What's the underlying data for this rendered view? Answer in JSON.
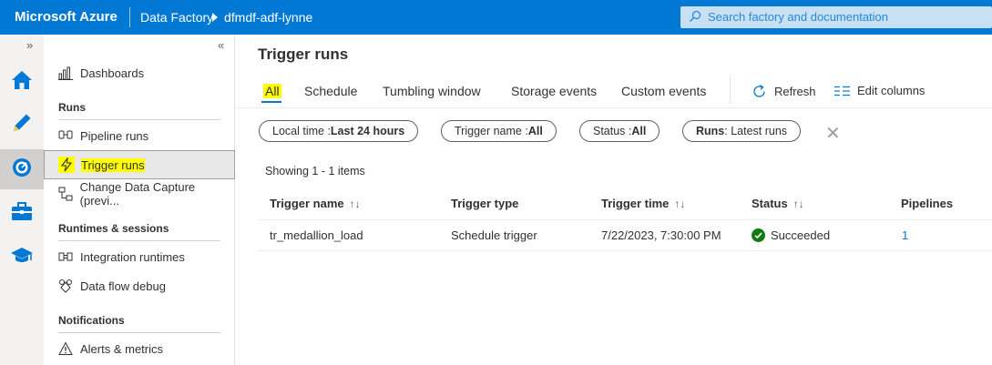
{
  "topbar": {
    "brand": "Microsoft Azure",
    "crumb_service": "Data Factory",
    "crumb_factory": "dfmdf-adf-lynne",
    "search_placeholder": "Search factory and documentation"
  },
  "rail": {
    "collapse": "»",
    "items": [
      {
        "icon": "home-icon"
      },
      {
        "icon": "pencil-icon"
      },
      {
        "icon": "monitor-icon",
        "active": true
      },
      {
        "icon": "toolbox-icon"
      },
      {
        "icon": "graduation-cap-icon"
      }
    ]
  },
  "sidenav": {
    "collapse": "«",
    "dashboards": "Dashboards",
    "runs_header": "Runs",
    "pipeline_runs": "Pipeline runs",
    "trigger_runs": "Trigger runs",
    "change_data_capture": "Change Data Capture (previ...",
    "runtimes_header": "Runtimes & sessions",
    "integration_runtimes": "Integration runtimes",
    "data_flow_debug": "Data flow debug",
    "notifications_header": "Notifications",
    "alerts_metrics": "Alerts & metrics"
  },
  "main": {
    "title": "Trigger runs",
    "tabs": [
      "All",
      "Schedule",
      "Tumbling window",
      "Storage events",
      "Custom events"
    ],
    "active_tab": "All",
    "refresh": "Refresh",
    "edit_columns": "Edit columns",
    "filters": {
      "time_label": "Local time : ",
      "time_value": "Last 24 hours",
      "trigger_label": "Trigger name : ",
      "trigger_value": "All",
      "status_label": "Status : ",
      "status_value": "All",
      "runs_label": "Runs",
      "runs_value": " : Latest runs"
    },
    "showing": "Showing 1 - 1 items",
    "columns": [
      "Trigger name",
      "Trigger type",
      "Trigger time",
      "Status",
      "Pipelines"
    ],
    "sort_glyph": "↑↓",
    "rows": [
      {
        "trigger_name": "tr_medallion_load",
        "trigger_type": "Schedule trigger",
        "trigger_time": "7/22/2023, 7:30:00 PM",
        "status": "Succeeded",
        "pipelines": "1"
      }
    ]
  },
  "colors": {
    "brand_blue": "#0078d4",
    "highlight": "#ffff00",
    "success": "#107c10"
  }
}
